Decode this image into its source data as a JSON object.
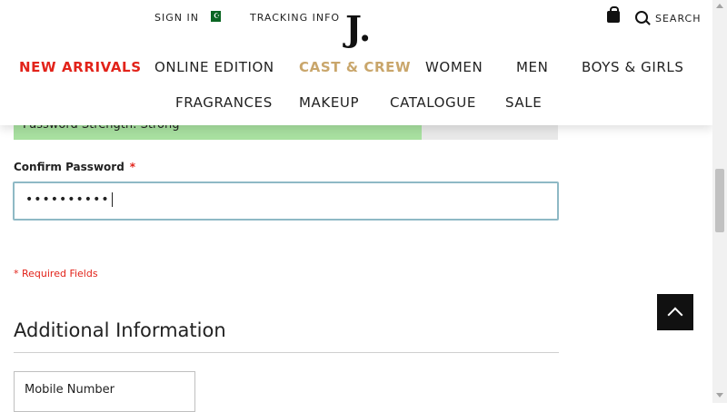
{
  "header": {
    "sign_in": "SIGN IN",
    "tracking": "TRACKING INFO",
    "logo": "J.",
    "search": "SEARCH",
    "flag_icon": "pakistan-flag-icon",
    "nav_row1": [
      "NEW ARRIVALS",
      "ONLINE EDITION",
      "CAST & CREW",
      "WOMEN",
      "MEN",
      "BOYS & GIRLS"
    ],
    "nav_row2": [
      "FRAGRANCES",
      "MAKEUP",
      "CATALOGUE",
      "SALE"
    ]
  },
  "form": {
    "strength_text": "Password Strength: Strong",
    "strength_level": 0.75,
    "confirm_label": "Confirm Password",
    "required_star": "*",
    "confirm_value": "••••••••••",
    "required_note": "* Required Fields",
    "section_title": "Additional Information",
    "mobile_label": "Mobile Number"
  },
  "colors": {
    "accent_red": "#e2231a",
    "accent_gold": "#c9a66b",
    "strength_green": "#a8e0a0",
    "focus_border": "#8eb9c5"
  }
}
